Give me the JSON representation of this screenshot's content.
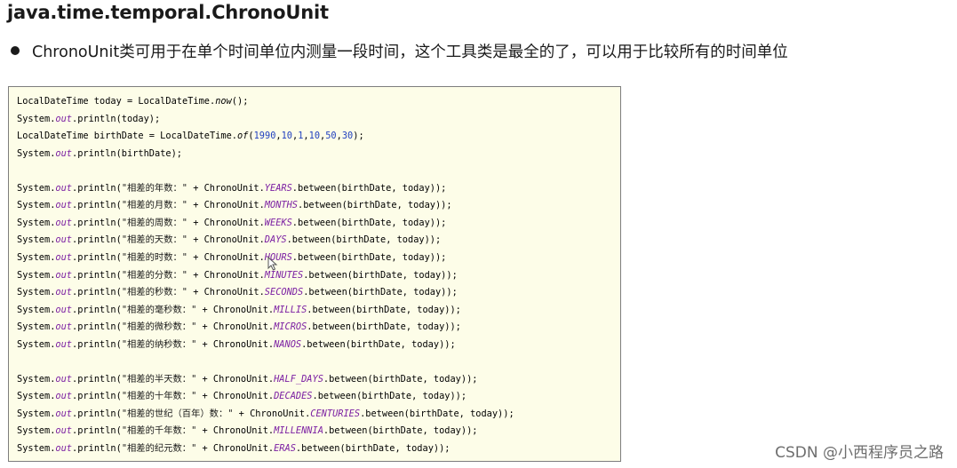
{
  "heading": "java.time.temporal.ChronoUnit",
  "bullet": {
    "icon": "bullet-dot-icon",
    "text": "ChronoUnit类可用于在单个时间单位内测量一段时间，这个工具类是最全的了，可以用于比较所有的时间单位"
  },
  "code": {
    "lines": [
      [
        {
          "t": "LocalDateTime today = LocalDateTime."
        },
        {
          "t": "now",
          "c": "mth"
        },
        {
          "t": "();"
        }
      ],
      [
        {
          "t": "System."
        },
        {
          "t": "out",
          "c": "fld"
        },
        {
          "t": ".println(today);"
        }
      ],
      [
        {
          "t": "LocalDateTime birthDate = LocalDateTime."
        },
        {
          "t": "of",
          "c": "mth"
        },
        {
          "t": "("
        },
        {
          "t": "1990",
          "c": "num"
        },
        {
          "t": ","
        },
        {
          "t": "10",
          "c": "num"
        },
        {
          "t": ","
        },
        {
          "t": "1",
          "c": "num"
        },
        {
          "t": ","
        },
        {
          "t": "10",
          "c": "num"
        },
        {
          "t": ","
        },
        {
          "t": "50",
          "c": "num"
        },
        {
          "t": ","
        },
        {
          "t": "30",
          "c": "num"
        },
        {
          "t": ");"
        }
      ],
      [
        {
          "t": "System."
        },
        {
          "t": "out",
          "c": "fld"
        },
        {
          "t": ".println(birthDate);"
        }
      ],
      [],
      [
        {
          "t": "System."
        },
        {
          "t": "out",
          "c": "fld"
        },
        {
          "t": ".println("
        },
        {
          "t": "\"相差的年数：\"",
          "c": "str"
        },
        {
          "t": " + ChronoUnit."
        },
        {
          "t": "YEARS",
          "c": "fld"
        },
        {
          "t": ".between(birthDate, today));"
        }
      ],
      [
        {
          "t": "System."
        },
        {
          "t": "out",
          "c": "fld"
        },
        {
          "t": ".println("
        },
        {
          "t": "\"相差的月数：\"",
          "c": "str"
        },
        {
          "t": " + ChronoUnit."
        },
        {
          "t": "MONTHS",
          "c": "fld"
        },
        {
          "t": ".between(birthDate, today));"
        }
      ],
      [
        {
          "t": "System."
        },
        {
          "t": "out",
          "c": "fld"
        },
        {
          "t": ".println("
        },
        {
          "t": "\"相差的周数：\"",
          "c": "str"
        },
        {
          "t": " + ChronoUnit."
        },
        {
          "t": "WEEKS",
          "c": "fld"
        },
        {
          "t": ".between(birthDate, today));"
        }
      ],
      [
        {
          "t": "System."
        },
        {
          "t": "out",
          "c": "fld"
        },
        {
          "t": ".println("
        },
        {
          "t": "\"相差的天数：\"",
          "c": "str"
        },
        {
          "t": " + ChronoUnit."
        },
        {
          "t": "DAYS",
          "c": "fld"
        },
        {
          "t": ".between(birthDate, today));"
        }
      ],
      [
        {
          "t": "System."
        },
        {
          "t": "out",
          "c": "fld"
        },
        {
          "t": ".println("
        },
        {
          "t": "\"相差的时数：\"",
          "c": "str"
        },
        {
          "t": " + ChronoUnit."
        },
        {
          "t": "HOURS",
          "c": "fld"
        },
        {
          "t": ".between(birthDate, today));"
        }
      ],
      [
        {
          "t": "System."
        },
        {
          "t": "out",
          "c": "fld"
        },
        {
          "t": ".println("
        },
        {
          "t": "\"相差的分数：\"",
          "c": "str"
        },
        {
          "t": " + ChronoUnit."
        },
        {
          "t": "MINUTES",
          "c": "fld"
        },
        {
          "t": ".between(birthDate, today));"
        }
      ],
      [
        {
          "t": "System."
        },
        {
          "t": "out",
          "c": "fld"
        },
        {
          "t": ".println("
        },
        {
          "t": "\"相差的秒数：\"",
          "c": "str"
        },
        {
          "t": " + ChronoUnit."
        },
        {
          "t": "SECONDS",
          "c": "fld"
        },
        {
          "t": ".between(birthDate, today));"
        }
      ],
      [
        {
          "t": "System."
        },
        {
          "t": "out",
          "c": "fld"
        },
        {
          "t": ".println("
        },
        {
          "t": "\"相差的毫秒数：\"",
          "c": "str"
        },
        {
          "t": " + ChronoUnit."
        },
        {
          "t": "MILLIS",
          "c": "fld"
        },
        {
          "t": ".between(birthDate, today));"
        }
      ],
      [
        {
          "t": "System."
        },
        {
          "t": "out",
          "c": "fld"
        },
        {
          "t": ".println("
        },
        {
          "t": "\"相差的微秒数：\"",
          "c": "str"
        },
        {
          "t": " + ChronoUnit."
        },
        {
          "t": "MICROS",
          "c": "fld"
        },
        {
          "t": ".between(birthDate, today));"
        }
      ],
      [
        {
          "t": "System."
        },
        {
          "t": "out",
          "c": "fld"
        },
        {
          "t": ".println("
        },
        {
          "t": "\"相差的纳秒数：\"",
          "c": "str"
        },
        {
          "t": " + ChronoUnit."
        },
        {
          "t": "NANOS",
          "c": "fld"
        },
        {
          "t": ".between(birthDate, today));"
        }
      ],
      [],
      [
        {
          "t": "System."
        },
        {
          "t": "out",
          "c": "fld"
        },
        {
          "t": ".println("
        },
        {
          "t": "\"相差的半天数：\"",
          "c": "str"
        },
        {
          "t": " + ChronoUnit."
        },
        {
          "t": "HALF_DAYS",
          "c": "fld"
        },
        {
          "t": ".between(birthDate, today));"
        }
      ],
      [
        {
          "t": "System."
        },
        {
          "t": "out",
          "c": "fld"
        },
        {
          "t": ".println("
        },
        {
          "t": "\"相差的十年数：\"",
          "c": "str"
        },
        {
          "t": " + ChronoUnit."
        },
        {
          "t": "DECADES",
          "c": "fld"
        },
        {
          "t": ".between(birthDate, today));"
        }
      ],
      [
        {
          "t": "System."
        },
        {
          "t": "out",
          "c": "fld"
        },
        {
          "t": ".println("
        },
        {
          "t": "\"相差的世纪（百年）数：\"",
          "c": "str"
        },
        {
          "t": " + ChronoUnit."
        },
        {
          "t": "CENTURIES",
          "c": "fld"
        },
        {
          "t": ".between(birthDate, today));"
        }
      ],
      [
        {
          "t": "System."
        },
        {
          "t": "out",
          "c": "fld"
        },
        {
          "t": ".println("
        },
        {
          "t": "\"相差的千年数：\"",
          "c": "str"
        },
        {
          "t": " + ChronoUnit."
        },
        {
          "t": "MILLENNIA",
          "c": "fld"
        },
        {
          "t": ".between(birthDate, today));"
        }
      ],
      [
        {
          "t": "System."
        },
        {
          "t": "out",
          "c": "fld"
        },
        {
          "t": ".println("
        },
        {
          "t": "\"相差的纪元数：\"",
          "c": "str"
        },
        {
          "t": " + ChronoUnit."
        },
        {
          "t": "ERAS",
          "c": "fld"
        },
        {
          "t": ".between(birthDate, today));"
        }
      ]
    ]
  },
  "watermark": "CSDN @小西程序员之路",
  "cursor": {
    "icon": "mouse-pointer-icon"
  }
}
